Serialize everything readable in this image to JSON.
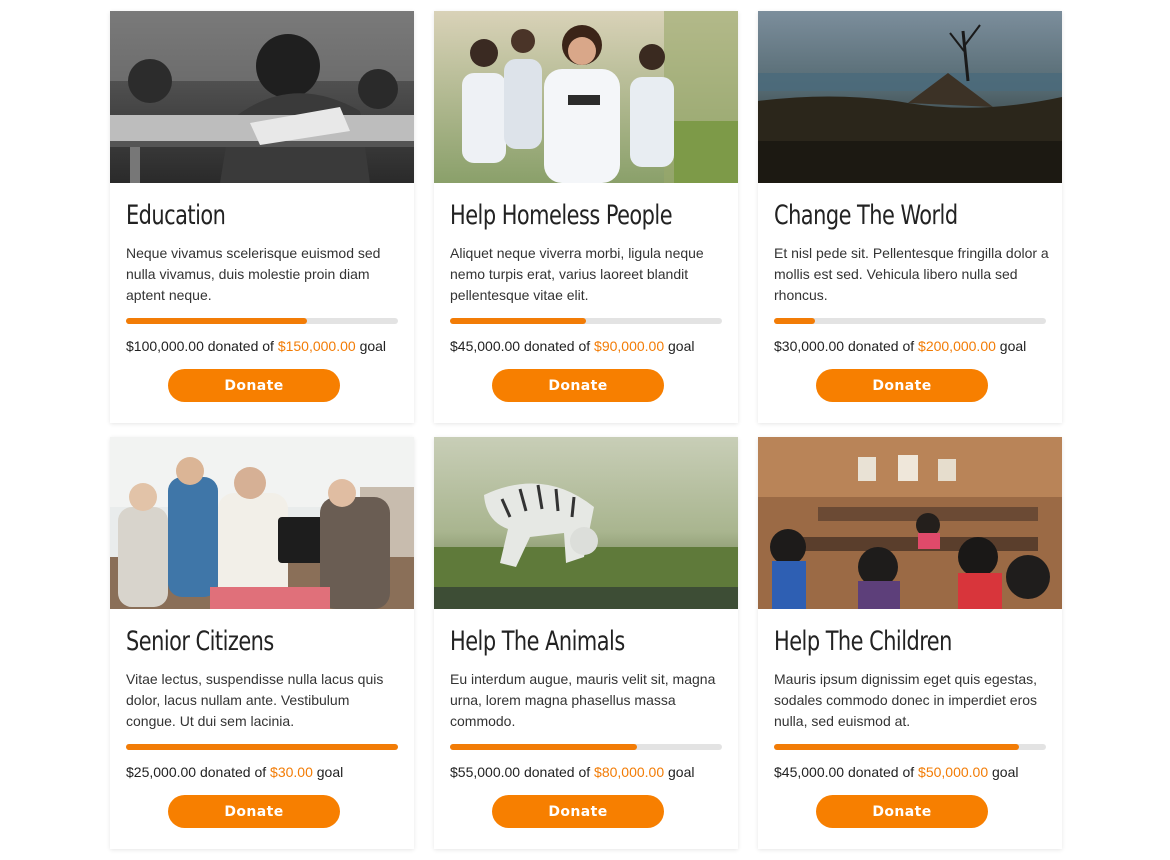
{
  "colors": {
    "accent": "#f77f00",
    "goal_text": "#f27c06",
    "progress_track": "#e3e3e3"
  },
  "campaigns": [
    {
      "title": "Education",
      "image": "children-writing-at-desk-photo",
      "description": "Neque vivamus scelerisque euismod sed nulla vivamus, duis molestie proin diam aptent neque.",
      "donated": "$100,000.00",
      "donated_label": "donated of",
      "goal": "$150,000.00",
      "goal_label": "goal",
      "progress": 0.667,
      "button": "Donate"
    },
    {
      "title": "Help Homeless People",
      "image": "volunteers-group-photo",
      "description": "Aliquet neque viverra morbi, ligula neque nemo turpis erat, varius laoreet blandit pellentesque vitae elit.",
      "donated": "$45,000.00",
      "donated_label": "donated of",
      "goal": "$90,000.00",
      "goal_label": "goal",
      "progress": 0.5,
      "button": "Donate"
    },
    {
      "title": "Change The World",
      "image": "burnt-landscape-photo",
      "description": "Et nisl pede sit. Pellentesque fringilla dolor a mollis est sed. Vehicula libero nulla sed rhoncus.",
      "donated": "$30,000.00",
      "donated_label": "donated of",
      "goal": "$200,000.00",
      "goal_label": "goal",
      "progress": 0.15,
      "button": "Donate"
    },
    {
      "title": "Senior Citizens",
      "image": "seniors-on-bench-photo",
      "description": "Vitae lectus, suspendisse nulla lacus quis dolor, lacus nullam ante. Vestibulum congue. Ut dui sem lacinia.",
      "donated": "$25,000.00",
      "donated_label": "donated of",
      "goal": "$30.00",
      "goal_label": "goal",
      "progress": 1.0,
      "button": "Donate"
    },
    {
      "title": "Help The Animals",
      "image": "white-tiger-in-grass-photo",
      "description": "Eu interdum augue, mauris velit sit, magna urna, lorem magna phasellus massa commodo.",
      "donated": "$55,000.00",
      "donated_label": "donated of",
      "goal": "$80,000.00",
      "goal_label": "goal",
      "progress": 0.6875,
      "button": "Donate"
    },
    {
      "title": "Help The Children",
      "image": "classroom-children-photo",
      "description": "Mauris ipsum dignissim eget quis egestas, sodales commodo donec in imperdiet eros nulla, sed euismod at.",
      "donated": "$45,000.00",
      "donated_label": "donated of",
      "goal": "$50,000.00",
      "goal_label": "goal",
      "progress": 0.9,
      "button": "Donate"
    }
  ]
}
